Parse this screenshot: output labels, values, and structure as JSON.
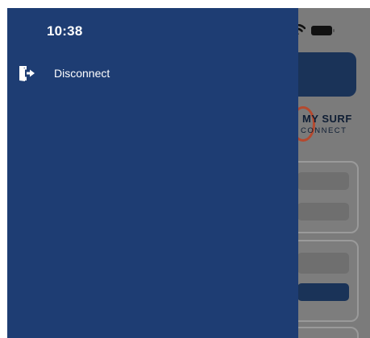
{
  "status_bar": {
    "time": "10:38",
    "icons": [
      "signal-icon",
      "wifi-icon",
      "battery-icon"
    ]
  },
  "drawer": {
    "background_color": "#1e3d73",
    "items": [
      {
        "icon": "logout-icon",
        "label": "Disconnect"
      }
    ]
  },
  "background_app": {
    "logo": {
      "line1": "MY SURF",
      "line2": "CONNECT"
    },
    "brand_color": "#1a3358",
    "accent_color": "#b5492e"
  }
}
